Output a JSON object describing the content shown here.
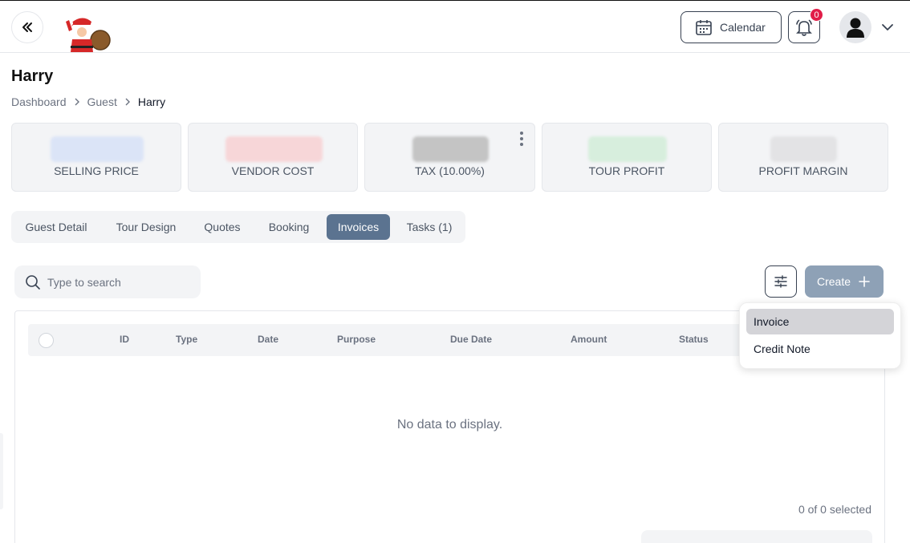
{
  "header": {
    "calendar_label": "Calendar",
    "notification_count": "0"
  },
  "page": {
    "title": "Harry",
    "breadcrumb": [
      "Dashboard",
      "Guest",
      "Harry"
    ]
  },
  "stats": [
    {
      "label": "SELLING PRICE",
      "color": "#dbe4f7"
    },
    {
      "label": "VENDOR COST",
      "color": "#f7d6d8"
    },
    {
      "label": "TAX (10.00%)",
      "color": "#c4c4c4"
    },
    {
      "label": "TOUR PROFIT",
      "color": "#d7eedd"
    },
    {
      "label": "PROFIT MARGIN",
      "color": "#e3e3e5"
    }
  ],
  "tabs": [
    {
      "label": "Guest Detail"
    },
    {
      "label": "Tour Design"
    },
    {
      "label": "Quotes"
    },
    {
      "label": "Booking"
    },
    {
      "label": "Invoices",
      "active": true
    },
    {
      "label": "Tasks (1)"
    }
  ],
  "toolbar": {
    "search_placeholder": "Type to search",
    "create_label": "Create"
  },
  "dropdown": {
    "items": [
      "Invoice",
      "Credit Note"
    ]
  },
  "table": {
    "columns": [
      "ID",
      "Type",
      "Date",
      "Purpose",
      "Due Date",
      "Amount",
      "Status"
    ],
    "empty_message": "No data to display.",
    "selected_count": "0 of 0 selected"
  }
}
